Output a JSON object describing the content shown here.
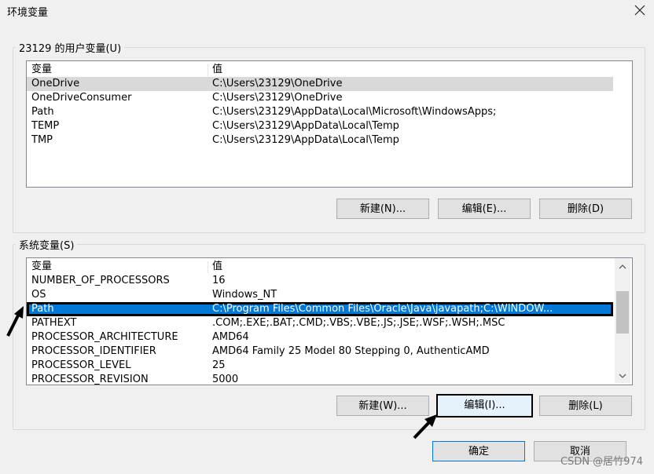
{
  "dialog": {
    "title": "环境变量",
    "close_icon": "close-icon"
  },
  "user_vars": {
    "group_label": "23129 的用户变量(U)",
    "headers": {
      "name": "变量",
      "value": "值"
    },
    "rows": [
      {
        "name": "OneDrive",
        "value": "C:\\Users\\23129\\OneDrive"
      },
      {
        "name": "OneDriveConsumer",
        "value": "C:\\Users\\23129\\OneDrive"
      },
      {
        "name": "Path",
        "value": "C:\\Users\\23129\\AppData\\Local\\Microsoft\\WindowsApps;"
      },
      {
        "name": "TEMP",
        "value": "C:\\Users\\23129\\AppData\\Local\\Temp"
      },
      {
        "name": "TMP",
        "value": "C:\\Users\\23129\\AppData\\Local\\Temp"
      }
    ],
    "buttons": {
      "new": "新建(N)...",
      "edit": "编辑(E)...",
      "delete": "删除(D)"
    }
  },
  "system_vars": {
    "group_label": "系统变量(S)",
    "headers": {
      "name": "变量",
      "value": "值"
    },
    "rows": [
      {
        "name": "NUMBER_OF_PROCESSORS",
        "value": "16"
      },
      {
        "name": "OS",
        "value": "Windows_NT"
      },
      {
        "name": "Path",
        "value": "C:\\Program Files\\Common Files\\Oracle\\Java\\javapath;C:\\WINDOW..."
      },
      {
        "name": "PATHEXT",
        "value": ".COM;.EXE;.BAT;.CMD;.VBS;.VBE;.JS;.JSE;.WSF;.WSH;.MSC"
      },
      {
        "name": "PROCESSOR_ARCHITECTURE",
        "value": "AMD64"
      },
      {
        "name": "PROCESSOR_IDENTIFIER",
        "value": "AMD64 Family 25 Model 80 Stepping 0, AuthenticAMD"
      },
      {
        "name": "PROCESSOR_LEVEL",
        "value": "25"
      },
      {
        "name": "PROCESSOR_REVISION",
        "value": "5000"
      }
    ],
    "selected_row": "Path",
    "buttons": {
      "new": "新建(W)...",
      "edit": "编辑(I)...",
      "delete": "删除(L)"
    }
  },
  "footer": {
    "ok": "确定",
    "cancel": "取消"
  },
  "watermark": "CSDN @居竹974",
  "colors": {
    "selection": "#0078d7",
    "annotation": "#000000"
  }
}
